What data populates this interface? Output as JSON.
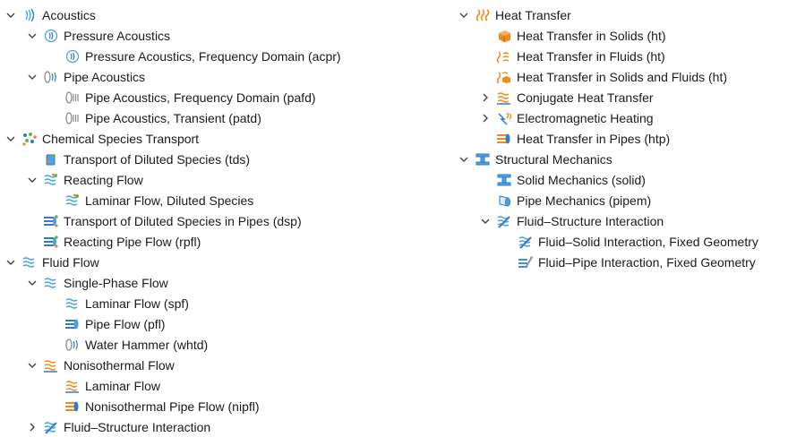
{
  "left_tree": [
    {
      "label": "Acoustics",
      "depth": 0,
      "chevron": "down",
      "icon": "acoustics-icon",
      "icon_type": "waves-blue"
    },
    {
      "label": "Pressure Acoustics",
      "depth": 1,
      "chevron": "down",
      "icon": "pressure-acoustics-icon",
      "icon_type": "circle-waves"
    },
    {
      "label": "Pressure Acoustics, Frequency Domain (acpr)",
      "depth": 2,
      "chevron": "none",
      "icon": "pressure-acoustics-frequency-icon",
      "icon_type": "circle-waves"
    },
    {
      "label": "Pipe Acoustics",
      "depth": 1,
      "chevron": "down",
      "icon": "pipe-acoustics-icon",
      "icon_type": "pipe-waves"
    },
    {
      "label": "Pipe Acoustics, Frequency Domain (pafd)",
      "depth": 2,
      "chevron": "none",
      "icon": "pipe-acoustics-frequency-icon",
      "icon_type": "pipe-gray"
    },
    {
      "label": "Pipe Acoustics, Transient (patd)",
      "depth": 2,
      "chevron": "none",
      "icon": "pipe-acoustics-transient-icon",
      "icon_type": "pipe-gray"
    },
    {
      "label": "Chemical Species Transport",
      "depth": 0,
      "chevron": "down",
      "icon": "chemical-species-icon",
      "icon_type": "dots"
    },
    {
      "label": "Transport of Diluted Species (tds)",
      "depth": 1,
      "chevron": "none",
      "icon": "diluted-species-icon",
      "icon_type": "beaker"
    },
    {
      "label": "Reacting Flow",
      "depth": 1,
      "chevron": "down",
      "icon": "reacting-flow-icon",
      "icon_type": "flow-dots"
    },
    {
      "label": "Laminar Flow, Diluted Species",
      "depth": 2,
      "chevron": "none",
      "icon": "laminar-flow-diluted-icon",
      "icon_type": "flow-dots"
    },
    {
      "label": "Transport of Diluted Species in Pipes (dsp)",
      "depth": 1,
      "chevron": "none",
      "icon": "diluted-species-pipes-icon",
      "icon_type": "pipe-dots"
    },
    {
      "label": "Reacting Pipe Flow (rpfl)",
      "depth": 1,
      "chevron": "none",
      "icon": "reacting-pipe-flow-icon",
      "icon_type": "pipe-dots"
    },
    {
      "label": "Fluid Flow",
      "depth": 0,
      "chevron": "down",
      "icon": "fluid-flow-icon",
      "icon_type": "flow"
    },
    {
      "label": "Single-Phase Flow",
      "depth": 1,
      "chevron": "down",
      "icon": "single-phase-flow-icon",
      "icon_type": "flow"
    },
    {
      "label": "Laminar Flow (spf)",
      "depth": 2,
      "chevron": "none",
      "icon": "laminar-flow-icon",
      "icon_type": "flow"
    },
    {
      "label": "Pipe Flow (pfl)",
      "depth": 2,
      "chevron": "none",
      "icon": "pipe-flow-icon",
      "icon_type": "pipe-blue"
    },
    {
      "label": "Water Hammer (whtd)",
      "depth": 2,
      "chevron": "none",
      "icon": "water-hammer-icon",
      "icon_type": "pipe-waves"
    },
    {
      "label": "Nonisothermal Flow",
      "depth": 1,
      "chevron": "down",
      "icon": "nonisothermal-flow-icon",
      "icon_type": "flow-orange"
    },
    {
      "label": "Laminar Flow",
      "depth": 2,
      "chevron": "none",
      "icon": "nonisothermal-laminar-icon",
      "icon_type": "flow-orange"
    },
    {
      "label": "Nonisothermal Pipe Flow (nipfl)",
      "depth": 2,
      "chevron": "none",
      "icon": "nonisothermal-pipe-flow-icon",
      "icon_type": "pipe-orange"
    },
    {
      "label": "Fluid–Structure Interaction",
      "depth": 1,
      "chevron": "right",
      "icon": "fluid-structure-interaction-icon",
      "icon_type": "fsi"
    }
  ],
  "right_tree": [
    {
      "label": "Heat Transfer",
      "depth": 0,
      "chevron": "down",
      "icon": "heat-transfer-icon",
      "icon_type": "heat-waves"
    },
    {
      "label": "Heat Transfer in Solids (ht)",
      "depth": 1,
      "chevron": "none",
      "icon": "heat-solids-icon",
      "icon_type": "cube-orange"
    },
    {
      "label": "Heat Transfer in Fluids (ht)",
      "depth": 1,
      "chevron": "none",
      "icon": "heat-fluids-icon",
      "icon_type": "heat-flow"
    },
    {
      "label": "Heat Transfer in Solids and Fluids (ht)",
      "depth": 1,
      "chevron": "none",
      "icon": "heat-solids-fluids-icon",
      "icon_type": "heat-flow-cube"
    },
    {
      "label": "Conjugate Heat Transfer",
      "depth": 1,
      "chevron": "right",
      "icon": "conjugate-heat-icon",
      "icon_type": "flow-orange"
    },
    {
      "label": "Electromagnetic Heating",
      "depth": 1,
      "chevron": "right",
      "icon": "electromagnetic-heating-icon",
      "icon_type": "em-heat"
    },
    {
      "label": "Heat Transfer in Pipes (htp)",
      "depth": 1,
      "chevron": "none",
      "icon": "heat-pipes-icon",
      "icon_type": "pipe-orange"
    },
    {
      "label": "Structural Mechanics",
      "depth": 0,
      "chevron": "down",
      "icon": "structural-mechanics-icon",
      "icon_type": "beam"
    },
    {
      "label": "Solid Mechanics (solid)",
      "depth": 1,
      "chevron": "none",
      "icon": "solid-mechanics-icon",
      "icon_type": "beam"
    },
    {
      "label": "Pipe Mechanics (pipem)",
      "depth": 1,
      "chevron": "none",
      "icon": "pipe-mechanics-icon",
      "icon_type": "cylinder"
    },
    {
      "label": "Fluid–Structure Interaction",
      "depth": 1,
      "chevron": "down",
      "icon": "fsi-structural-icon",
      "icon_type": "fsi"
    },
    {
      "label": "Fluid–Solid Interaction, Fixed Geometry",
      "depth": 2,
      "chevron": "none",
      "icon": "fluid-solid-fixed-icon",
      "icon_type": "fsi"
    },
    {
      "label": "Fluid–Pipe Interaction, Fixed Geometry",
      "depth": 2,
      "chevron": "none",
      "icon": "fluid-pipe-fixed-icon",
      "icon_type": "pipe-fsi"
    }
  ],
  "colors": {
    "blue": "#2f7cc8",
    "light_blue": "#4aa3e0",
    "orange": "#f08a1e",
    "gray": "#8a8a8a",
    "chevron": "#444444",
    "green": "#6fb23a"
  }
}
